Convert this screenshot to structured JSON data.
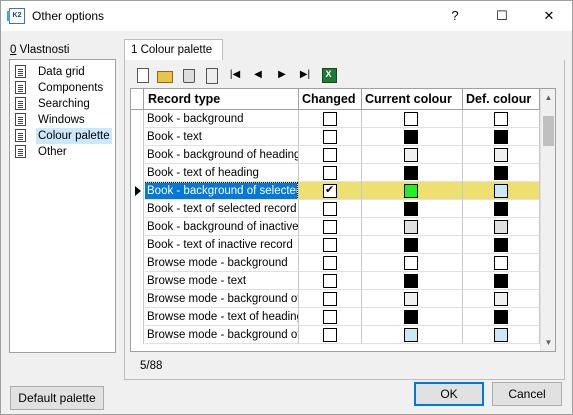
{
  "window": {
    "title": "Other options",
    "app_icon_text": "K2"
  },
  "titlebar_buttons": {
    "help": "?",
    "minimize": "–",
    "maximize": "☐",
    "close": "✕"
  },
  "left_panel": {
    "label_prefix": "0",
    "label_text": " Vlastnosti",
    "items": [
      {
        "label": "Data grid"
      },
      {
        "label": "Components"
      },
      {
        "label": "Searching"
      },
      {
        "label": "Windows"
      },
      {
        "label": "Colour palette",
        "selected": true
      },
      {
        "label": "Other"
      }
    ]
  },
  "tab": {
    "label": "1 Colour palette"
  },
  "toolbar": {
    "icons": [
      "new-icon",
      "open-folder-icon",
      "delete-icon",
      "calculator-icon",
      "first-record-icon",
      "previous-record-icon",
      "next-record-icon",
      "last-record-icon",
      "excel-export-icon"
    ],
    "first": "|◀",
    "prev": "◀",
    "next": "▶",
    "last": "▶|"
  },
  "grid": {
    "columns": [
      "Record type",
      "Changed",
      "Current colour",
      "Def. colour"
    ],
    "rows": [
      {
        "name": "Book - background",
        "changed": false,
        "current": "#ffffff",
        "default": "#ffffff"
      },
      {
        "name": "Book - text",
        "changed": false,
        "current": "#000000",
        "default": "#000000"
      },
      {
        "name": "Book - background of heading",
        "changed": false,
        "current": "#f0f0f0",
        "default": "#f0f0f0"
      },
      {
        "name": "Book - text of heading",
        "changed": false,
        "current": "#000000",
        "default": "#000000"
      },
      {
        "name": "Book - background of selected",
        "changed": true,
        "current": "#22ee22",
        "default": "#cce8f4",
        "selected": true
      },
      {
        "name": "Book - text of selected record",
        "changed": false,
        "current": "#000000",
        "default": "#000000"
      },
      {
        "name": "Book - background of inactive re",
        "changed": false,
        "current": "#e0e0e0",
        "default": "#e0e0e0"
      },
      {
        "name": "Book - text of inactive record",
        "changed": false,
        "current": "#000000",
        "default": "#000000"
      },
      {
        "name": "Browse mode - background",
        "changed": false,
        "current": "#ffffff",
        "default": "#ffffff"
      },
      {
        "name": "Browse mode - text",
        "changed": false,
        "current": "#000000",
        "default": "#000000"
      },
      {
        "name": "Browse mode - background of h",
        "changed": false,
        "current": "#f0f0f0",
        "default": "#f0f0f0"
      },
      {
        "name": "Browse mode - text of heading",
        "changed": false,
        "current": "#000000",
        "default": "#000000"
      },
      {
        "name": "Browse mode - background of s",
        "changed": false,
        "current": "#cce8f4",
        "default": "#cce8f4"
      }
    ],
    "selected_row_color": "#ede070",
    "selection_color": "#0078d7"
  },
  "status": {
    "record_counter": "5/88"
  },
  "buttons": {
    "default_palette": "Default palette",
    "ok": "OK",
    "cancel": "Cancel"
  }
}
